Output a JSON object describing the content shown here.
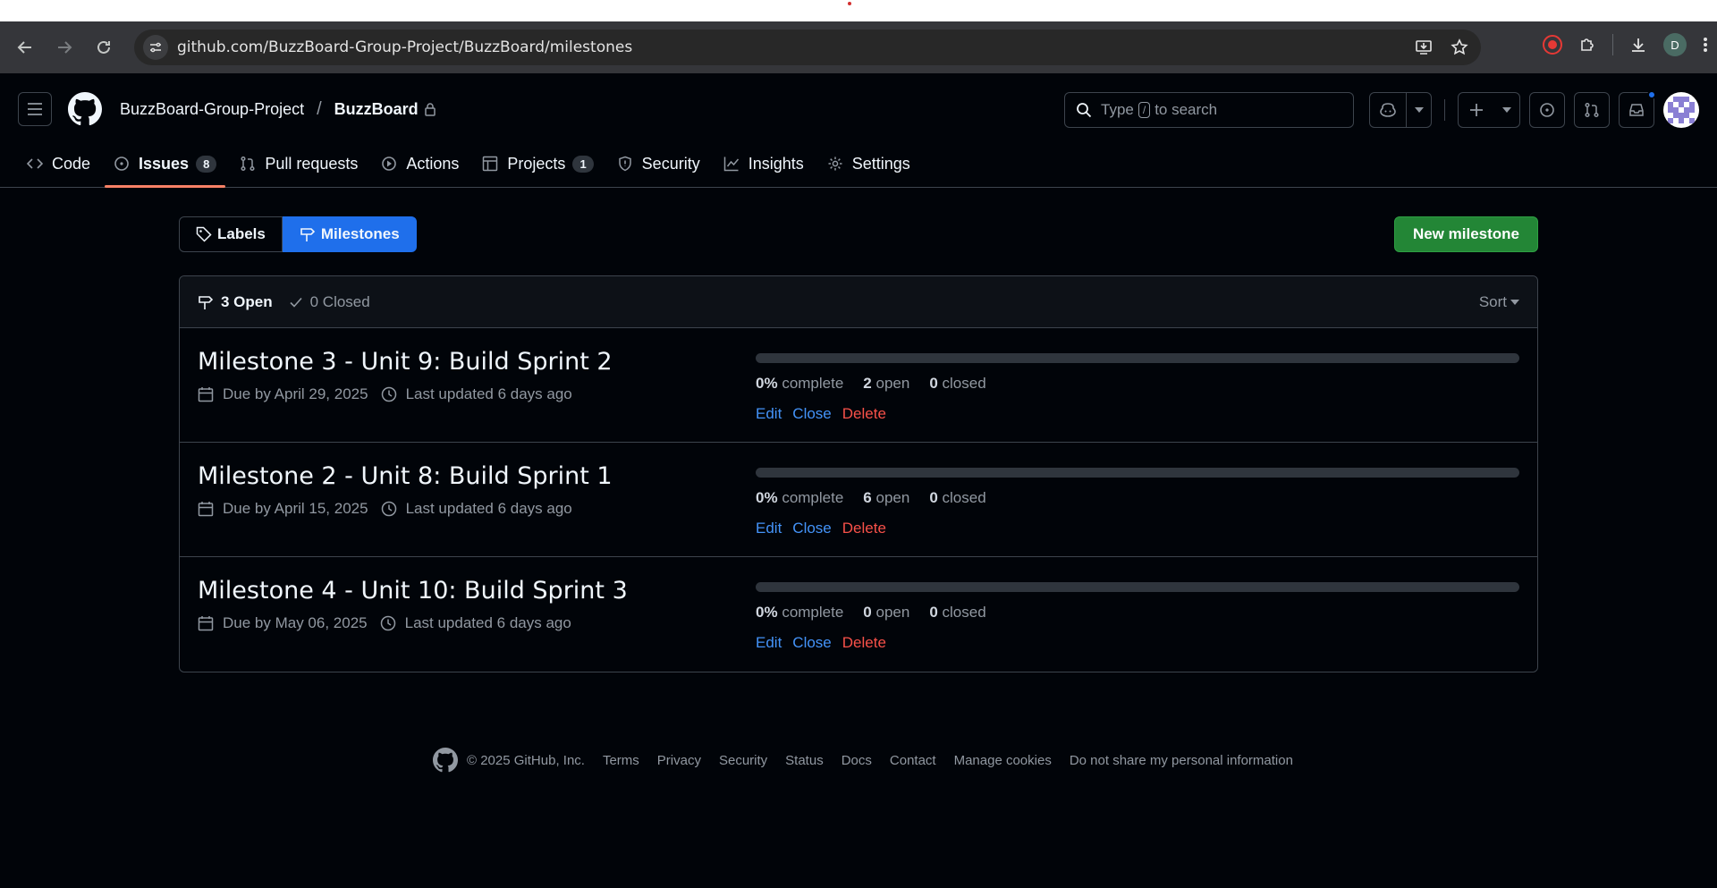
{
  "browser": {
    "url": "github.com/BuzzBoard-Group-Project/BuzzBoard/milestones",
    "profile_initial": "D"
  },
  "header": {
    "owner": "BuzzBoard-Group-Project",
    "separator": "/",
    "repo": "BuzzBoard",
    "search_prefix": "Type",
    "search_key": "/",
    "search_suffix": "to search"
  },
  "nav": {
    "tabs": [
      {
        "label": "Code",
        "icon": "code-icon"
      },
      {
        "label": "Issues",
        "icon": "issue-icon",
        "count": "8",
        "active": true
      },
      {
        "label": "Pull requests",
        "icon": "pull-request-icon"
      },
      {
        "label": "Actions",
        "icon": "play-icon"
      },
      {
        "label": "Projects",
        "icon": "table-icon",
        "count": "1"
      },
      {
        "label": "Security",
        "icon": "shield-icon"
      },
      {
        "label": "Insights",
        "icon": "graph-icon"
      },
      {
        "label": "Settings",
        "icon": "gear-icon"
      }
    ]
  },
  "toolbar": {
    "labels_label": "Labels",
    "milestones_label": "Milestones",
    "new_milestone_label": "New milestone"
  },
  "list": {
    "open_label": "3 Open",
    "closed_label": "0 Closed",
    "sort_label": "Sort"
  },
  "milestones": [
    {
      "title": "Milestone 3 - Unit 9: Build Sprint 2",
      "due": "Due by April 29, 2025",
      "updated": "Last updated 6 days ago",
      "percent": "0%",
      "percent_value": 0,
      "complete_label": "complete",
      "open_count": "2",
      "open_label": "open",
      "closed_count": "0",
      "closed_label": "closed",
      "edit": "Edit",
      "close": "Close",
      "delete": "Delete"
    },
    {
      "title": "Milestone 2 - Unit 8: Build Sprint 1",
      "due": "Due by April 15, 2025",
      "updated": "Last updated 6 days ago",
      "percent": "0%",
      "percent_value": 0,
      "complete_label": "complete",
      "open_count": "6",
      "open_label": "open",
      "closed_count": "0",
      "closed_label": "closed",
      "edit": "Edit",
      "close": "Close",
      "delete": "Delete"
    },
    {
      "title": "Milestone 4 - Unit 10: Build Sprint 3",
      "due": "Due by May 06, 2025",
      "updated": "Last updated 6 days ago",
      "percent": "0%",
      "percent_value": 0,
      "complete_label": "complete",
      "open_count": "0",
      "open_label": "open",
      "closed_count": "0",
      "closed_label": "closed",
      "edit": "Edit",
      "close": "Close",
      "delete": "Delete"
    }
  ],
  "footer": {
    "copyright": "© 2025 GitHub, Inc.",
    "links": [
      "Terms",
      "Privacy",
      "Security",
      "Status",
      "Docs",
      "Contact",
      "Manage cookies",
      "Do not share my personal information"
    ]
  },
  "colors": {
    "accent": "#1f6feb",
    "primary_button": "#238636",
    "danger": "#f85149",
    "active_tab_underline": "#f78166"
  }
}
